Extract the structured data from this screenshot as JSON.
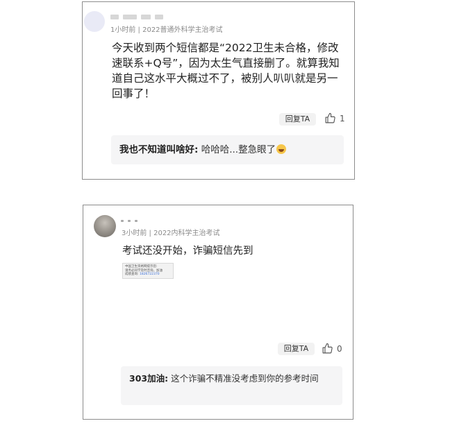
{
  "comments": [
    {
      "meta": "1小时前 | 2022普通外科学主治考试",
      "text": "今天收到两个短信都是“2022卫生未合格，修改速联系+Q号”，因为太生气直接删了。就算我知道自己这水平大概过不了，被别人叭叭就是另一回事了！",
      "reply_label": "回复TA",
      "likes": "1",
      "reply": {
        "author": "我也不知道叫啥好:",
        "text": " 哈哈哈...整急眼了"
      }
    },
    {
      "meta": "3小时前 | 2022内科学主治考试",
      "text": "考试还没开始，诈骗短信先到",
      "image_text": {
        "line1": "中国卫生资格网提示您:",
        "line2": "请务必同学及时咨询，加油",
        "line3_label": "成绩查询:",
        "line3_link": "1826722370"
      },
      "reply_label": "回复TA",
      "likes": "0",
      "reply": {
        "author": "303加油:",
        "text": " 这个诈骗不精准没考虑到你的参考时间"
      }
    }
  ],
  "icons": {
    "like": "thumbs-up-icon",
    "emoji": "laughing-emoji-icon"
  }
}
